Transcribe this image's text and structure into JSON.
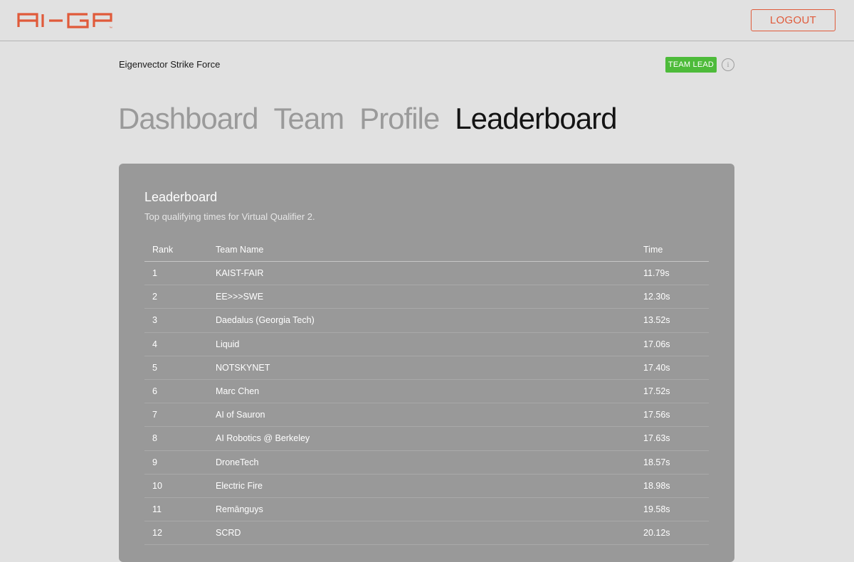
{
  "header": {
    "logo_text": "AI-GP",
    "logout_label": "LOGOUT",
    "brand_color": "#e05a3a"
  },
  "team": {
    "name": "Eigenvector Strike Force",
    "role_badge": "TEAM LEAD",
    "badge_color": "#4dbb3a",
    "info_glyph": "i"
  },
  "nav": {
    "tabs": [
      {
        "label": "Dashboard",
        "active": false
      },
      {
        "label": "Team",
        "active": false
      },
      {
        "label": "Profile",
        "active": false
      },
      {
        "label": "Leaderboard",
        "active": true
      }
    ]
  },
  "leaderboard": {
    "title": "Leaderboard",
    "subtitle": "Top qualifying times for Virtual Qualifier 2.",
    "columns": {
      "rank": "Rank",
      "team": "Team Name",
      "time": "Time"
    },
    "rows": [
      {
        "rank": "1",
        "team": "KAIST-FAIR",
        "time": "11.79s"
      },
      {
        "rank": "2",
        "team": "EE>>>SWE",
        "time": "12.30s"
      },
      {
        "rank": "3",
        "team": "Daedalus (Georgia Tech)",
        "time": "13.52s"
      },
      {
        "rank": "4",
        "team": "Liquid",
        "time": "17.06s"
      },
      {
        "rank": "5",
        "team": "NOTSKYNET",
        "time": "17.40s"
      },
      {
        "rank": "6",
        "team": "Marc Chen",
        "time": "17.52s"
      },
      {
        "rank": "7",
        "team": "AI of Sauron",
        "time": "17.56s"
      },
      {
        "rank": "8",
        "team": "AI Robotics @ Berkeley",
        "time": "17.63s"
      },
      {
        "rank": "9",
        "team": "DroneTech",
        "time": "18.57s"
      },
      {
        "rank": "10",
        "team": "Electric Fire",
        "time": "18.98s"
      },
      {
        "rank": "11",
        "team": "Remānguys",
        "time": "19.58s"
      },
      {
        "rank": "12",
        "team": "SCRD",
        "time": "20.12s"
      }
    ]
  }
}
